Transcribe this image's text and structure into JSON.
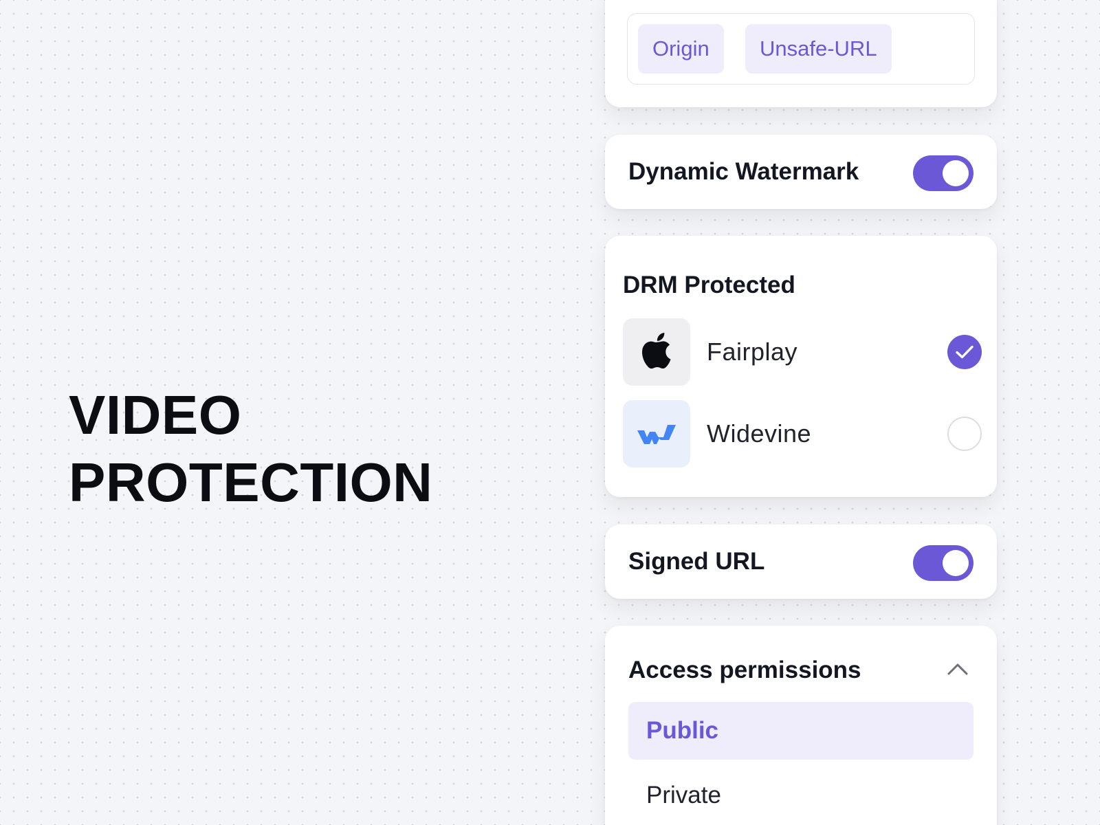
{
  "headline": {
    "line1": "VIDEO",
    "line2": "PROTECTION"
  },
  "tags": [
    {
      "label": "Origin"
    },
    {
      "label": "Unsafe-URL"
    }
  ],
  "watermark": {
    "label": "Dynamic Watermark",
    "enabled": true
  },
  "drm": {
    "title": "DRM Protected",
    "options": [
      {
        "name": "Fairplay",
        "icon": "apple-icon",
        "selected": true
      },
      {
        "name": "Widevine",
        "icon": "widevine-icon",
        "selected": false
      }
    ]
  },
  "signed_url": {
    "label": "Signed URL",
    "enabled": true
  },
  "access": {
    "title": "Access permissions",
    "expanded": true,
    "options": [
      {
        "label": "Public",
        "selected": true
      },
      {
        "label": "Private",
        "selected": false
      }
    ]
  },
  "colors": {
    "accent": "#6b58d6",
    "accent_soft": "#efedfb",
    "background": "#f4f5f8",
    "widevine_blue": "#4285f4"
  }
}
